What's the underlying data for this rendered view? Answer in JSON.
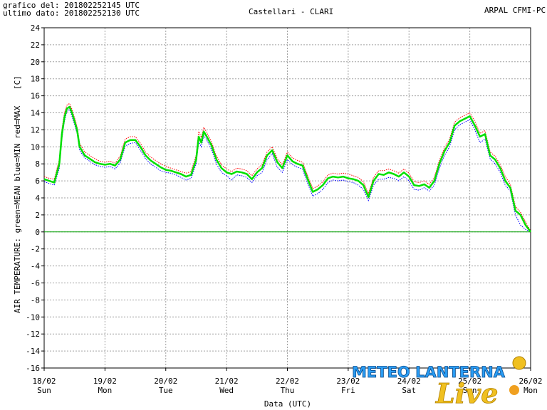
{
  "header": {
    "generated_label": "grafico del: 201802252145 UTC",
    "lastdata_label": "ultimo dato: 201802252130 UTC",
    "title": "Castellari - CLARI",
    "source": "ARPAL CFMI-PC"
  },
  "watermark": {
    "text": "METEO LANTERNA",
    "script": "Live"
  },
  "colors": {
    "mean": "#00e000",
    "min": "#0000ff",
    "max": "#ff0000",
    "zero_line": "#00a000",
    "grid": "#a0a0a0"
  },
  "chart_data": {
    "type": "line",
    "xlabel": "Data (UTC)",
    "ylabel": "AIR TEMPERATURE: green=MEAN  blue=MIN  red=MAX",
    "yunit": "[C]",
    "ylim": [
      -16,
      24
    ],
    "yticks": [
      24,
      22,
      20,
      18,
      16,
      14,
      12,
      10,
      8,
      6,
      4,
      2,
      0,
      -2,
      -4,
      -6,
      -8,
      -10,
      -12,
      -14,
      -16
    ],
    "xlim": [
      0,
      192
    ],
    "x_unit": "hours since 18/02 00:00 UTC",
    "xticks": [
      {
        "date": "18/02",
        "day": "Sun"
      },
      {
        "date": "19/02",
        "day": "Mon"
      },
      {
        "date": "20/02",
        "day": "Tue"
      },
      {
        "date": "21/02",
        "day": "Wed"
      },
      {
        "date": "22/02",
        "day": "Thu"
      },
      {
        "date": "23/02",
        "day": "Fri"
      },
      {
        "date": "24/02",
        "day": "Sat"
      },
      {
        "date": "25/02",
        "day": "Sun"
      },
      {
        "date": "26/02",
        "day": "Mon"
      }
    ],
    "grid": true,
    "series": [
      {
        "name": "MEAN",
        "x": [
          0,
          2,
          4,
          6,
          7,
          8,
          9,
          10,
          11,
          12,
          13,
          14,
          16,
          18,
          20,
          22,
          24,
          26,
          28,
          30,
          32,
          34,
          36,
          38,
          40,
          42,
          44,
          46,
          48,
          50,
          52,
          54,
          56,
          58,
          60,
          61,
          62,
          63,
          64,
          66,
          68,
          70,
          72,
          74,
          76,
          78,
          80,
          82,
          84,
          86,
          88,
          90,
          92,
          94,
          96,
          98,
          100,
          102,
          104,
          106,
          108,
          110,
          112,
          114,
          116,
          118,
          120,
          122,
          124,
          126,
          128,
          130,
          132,
          134,
          136,
          138,
          140,
          142,
          144,
          146,
          148,
          150,
          152,
          154,
          156,
          158,
          160,
          162,
          164,
          166,
          168,
          170,
          172,
          174,
          176,
          178,
          180,
          182,
          184,
          186,
          188,
          190,
          192
        ],
        "y": [
          6.2,
          6,
          5.8,
          8,
          11.5,
          13.5,
          14.5,
          14.7,
          14,
          13,
          12,
          10,
          9,
          8.6,
          8.2,
          8,
          7.9,
          8,
          7.8,
          8.5,
          10.5,
          10.8,
          10.8,
          10,
          9,
          8.4,
          8,
          7.6,
          7.3,
          7.2,
          7,
          6.8,
          6.5,
          6.7,
          8.5,
          11.2,
          10.5,
          11.8,
          11.3,
          10.2,
          8.5,
          7.5,
          7,
          6.8,
          7.1,
          7,
          6.8,
          6.2,
          7,
          7.5,
          9,
          9.6,
          8.2,
          7.5,
          9,
          8.3,
          8,
          7.8,
          6.2,
          4.7,
          5,
          5.5,
          6.3,
          6.5,
          6.4,
          6.5,
          6.3,
          6.2,
          6,
          5.5,
          4.1,
          6,
          6.8,
          6.7,
          7,
          6.8,
          6.5,
          7,
          6.5,
          5.5,
          5.4,
          5.6,
          5.2,
          6,
          8,
          9.5,
          10.5,
          12.5,
          13,
          13.3,
          13.6,
          12.5,
          11.2,
          11.5,
          11.8,
          10.5,
          9.5,
          9,
          8.9,
          9,
          8.5,
          7.5,
          6
        ]
      },
      {
        "name": "MIN",
        "x": [
          0,
          2,
          4,
          6,
          7,
          8,
          9,
          10,
          11,
          12,
          13,
          14,
          16,
          18,
          20,
          22,
          24,
          26,
          28,
          30,
          32,
          34,
          36,
          38,
          40,
          42,
          44,
          46,
          48,
          50,
          52,
          54,
          56,
          58,
          60,
          61,
          62,
          63,
          64,
          66,
          68,
          70,
          72,
          74,
          76,
          78,
          80,
          82,
          84,
          86,
          88,
          90,
          92,
          94,
          96,
          98,
          100,
          102,
          104,
          106,
          108,
          110,
          112,
          114,
          116,
          118,
          120,
          122,
          124,
          126,
          128,
          130,
          132,
          134,
          136,
          138,
          140,
          142,
          144,
          146,
          148,
          150,
          152,
          154,
          156,
          158,
          160,
          162,
          164,
          166,
          168,
          170,
          172,
          174,
          176,
          178,
          180,
          182,
          184,
          186,
          188,
          190,
          192
        ],
        "y": [
          5.9,
          5.7,
          5.5,
          7.5,
          11,
          13,
          14.2,
          14.4,
          13.6,
          12.6,
          11.6,
          9.6,
          8.7,
          8.3,
          7.9,
          7.7,
          7.6,
          7.7,
          7.4,
          8.1,
          10.1,
          10.4,
          10.5,
          9.6,
          8.6,
          8,
          7.6,
          7.2,
          7,
          6.9,
          6.7,
          6.4,
          6.1,
          6.3,
          8,
          10.6,
          10,
          11.3,
          10.9,
          9.7,
          8,
          7,
          6.6,
          6.1,
          6.7,
          6.6,
          6.4,
          5.8,
          6.6,
          7,
          8.5,
          9.2,
          7.6,
          7,
          8.5,
          7.9,
          7.6,
          7.4,
          5.7,
          4.2,
          4.5,
          5,
          5.8,
          6.1,
          6,
          6.1,
          5.9,
          5.8,
          5.5,
          5,
          3.7,
          5.5,
          6.2,
          6.2,
          6.4,
          6.3,
          6,
          6.5,
          6,
          5,
          4.9,
          5.2,
          4.8,
          5.5,
          7.5,
          9,
          10,
          12,
          12.6,
          12.9,
          13.2,
          12,
          10.5,
          10.9,
          11.2,
          10,
          9,
          8.5,
          8.5,
          8.6,
          8,
          7,
          5.5
        ]
      },
      {
        "name": "MAX",
        "x": [
          0,
          2,
          4,
          6,
          7,
          8,
          9,
          10,
          11,
          12,
          13,
          14,
          16,
          18,
          20,
          22,
          24,
          26,
          28,
          30,
          32,
          34,
          36,
          38,
          40,
          42,
          44,
          46,
          48,
          50,
          52,
          54,
          56,
          58,
          60,
          61,
          62,
          63,
          64,
          66,
          68,
          70,
          72,
          74,
          76,
          78,
          80,
          82,
          84,
          86,
          88,
          90,
          92,
          94,
          96,
          98,
          100,
          102,
          104,
          106,
          108,
          110,
          112,
          114,
          116,
          118,
          120,
          122,
          124,
          126,
          128,
          130,
          132,
          134,
          136,
          138,
          140,
          142,
          144,
          146,
          148,
          150,
          152,
          154,
          156,
          158,
          160,
          162,
          164,
          166,
          168,
          170,
          172,
          174,
          176,
          178,
          180,
          182,
          184,
          186,
          188,
          190,
          192
        ],
        "y": [
          6.5,
          6.3,
          6.2,
          8.5,
          12,
          14,
          14.9,
          15.1,
          14.4,
          13.4,
          12.4,
          10.4,
          9.4,
          9,
          8.6,
          8.3,
          8.2,
          8.3,
          8.1,
          8.9,
          10.9,
          11.2,
          11.2,
          10.4,
          9.4,
          8.8,
          8.4,
          8,
          7.7,
          7.5,
          7.3,
          7.1,
          6.9,
          7.1,
          9,
          11.8,
          11.1,
          12.3,
          11.8,
          10.6,
          8.9,
          7.9,
          7.4,
          7.1,
          7.5,
          7.4,
          7.2,
          6.6,
          7.4,
          7.9,
          9.4,
          10,
          8.6,
          7.9,
          9.4,
          8.7,
          8.4,
          8.2,
          6.6,
          5.1,
          5.4,
          5.9,
          6.7,
          6.9,
          6.8,
          6.9,
          6.8,
          6.6,
          6.4,
          5.9,
          4.5,
          6.4,
          7.2,
          7.2,
          7.4,
          7.2,
          6.9,
          7.4,
          6.9,
          5.9,
          5.8,
          6,
          5.6,
          6.4,
          8.4,
          9.9,
          10.9,
          12.9,
          13.4,
          13.7,
          14,
          13,
          11.6,
          11.9,
          12.2,
          10.9,
          9.9,
          9.4,
          9.3,
          9.4,
          8.9,
          7.9,
          6.5
        ]
      }
    ],
    "tail": {
      "x": [
        176,
        178,
        180,
        182,
        184,
        186,
        188,
        189,
        190,
        191,
        192
      ],
      "mean": [
        9,
        8.5,
        7.5,
        6,
        5.2,
        2.5,
        2,
        1.9,
        0.8,
        0.2,
        0
      ],
      "min": [
        8.6,
        8,
        7,
        5.5,
        4.8,
        2,
        0.8,
        0.8,
        0.3,
        0,
        0
      ],
      "max": [
        9.4,
        8.9,
        7.9,
        6.5,
        5.6,
        3,
        2.3,
        2.2,
        1.2,
        0.5,
        0.1
      ]
    }
  }
}
